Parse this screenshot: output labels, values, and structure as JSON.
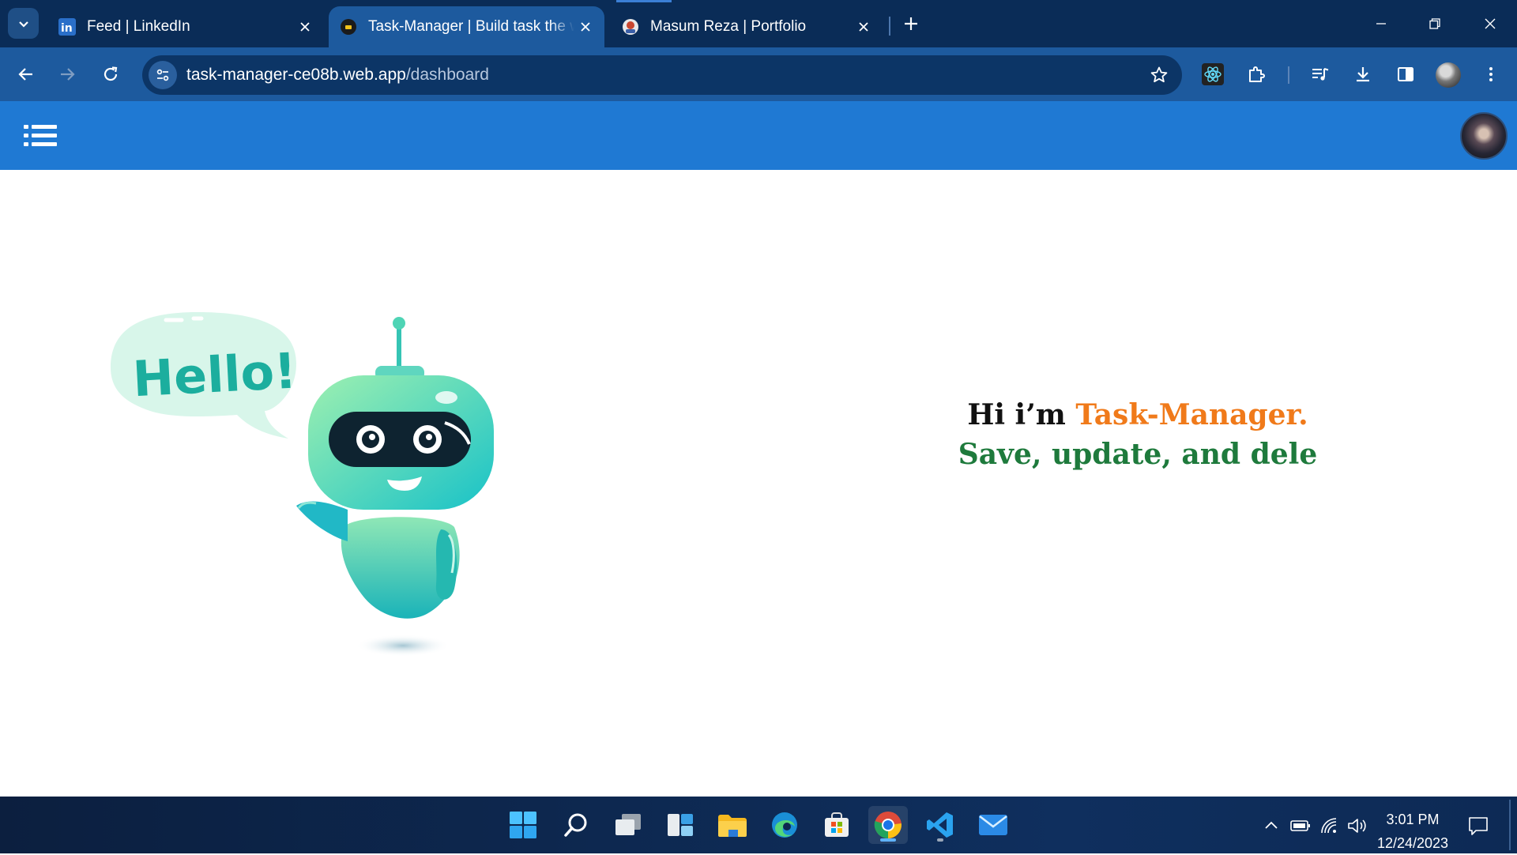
{
  "browser": {
    "tabs": [
      {
        "title": "Feed | LinkedIn",
        "favicon": "linkedin-icon",
        "active": false
      },
      {
        "title": "Task-Manager | Build task the w",
        "favicon": "task-manager-icon",
        "active": true
      },
      {
        "title": "Masum Reza | Portfolio",
        "favicon": "portfolio-icon",
        "active": false
      }
    ],
    "address": {
      "host": "task-manager-ce08b.web.app",
      "path": "/dashboard"
    },
    "colors": {
      "frame": "#0a2c57",
      "toolbar": "#1d5a9e",
      "omnibox": "#0c3566"
    }
  },
  "app": {
    "navbar_color": "#1f79d3",
    "hero": {
      "bubble_text": "Hello!",
      "greeting_prefix": "Hi i’m ",
      "app_name": "Task-Manager.",
      "typed_line": "Save, update, and dele"
    },
    "colors": {
      "accent_orange": "#f07a1a",
      "accent_green": "#1e7a3c"
    }
  },
  "taskbar": {
    "time": "3:01 PM",
    "date": "12/24/2023"
  }
}
